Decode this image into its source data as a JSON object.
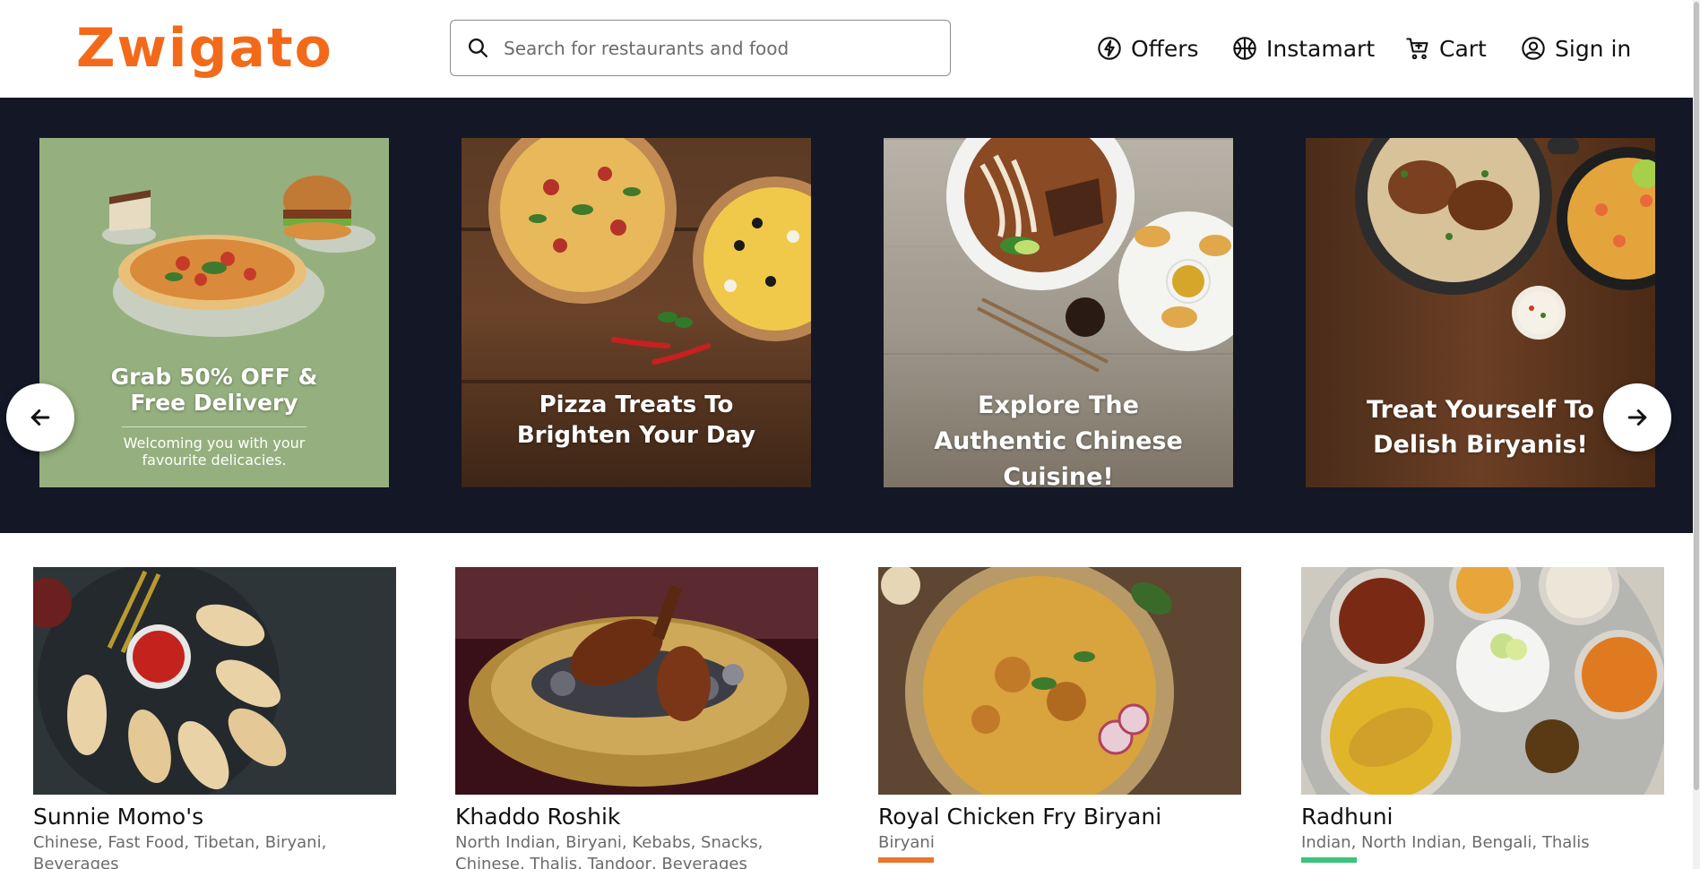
{
  "header": {
    "logo": "Zwigato",
    "search_placeholder": "Search for restaurants and food",
    "nav": {
      "offers": "Offers",
      "instamart": "Instamart",
      "cart": "Cart",
      "signin": "Sign in"
    }
  },
  "banner": {
    "slides": [
      {
        "title": "Grab 50% OFF & Free Delivery",
        "subtitle": "Welcoming you with your favourite delicacies."
      },
      {
        "title": "Pizza Treats To Brighten Your Day"
      },
      {
        "title": "Explore The Authentic Chinese Cuisine!"
      },
      {
        "title": "Treat Yourself To Delish Biryanis!"
      }
    ]
  },
  "restaurants": [
    {
      "name": "Sunnie Momo's",
      "cuisines": "Chinese, Fast Food, Tibetan, Biryani, Beverages"
    },
    {
      "name": "Khaddo Roshik",
      "cuisines": "North Indian, Biryani, Kebabs, Snacks, Chinese, Thalis, Tandoor, Beverages"
    },
    {
      "name": "Royal Chicken Fry Biryani",
      "cuisines": "Biryani"
    },
    {
      "name": "Radhuni",
      "cuisines": "Indian, North Indian, Bengali, Thalis"
    }
  ],
  "colors": {
    "brand": "#f26a19",
    "banner_bg": "#141726",
    "rating_orange": "#e8772e",
    "rating_green": "#3ec37a"
  }
}
